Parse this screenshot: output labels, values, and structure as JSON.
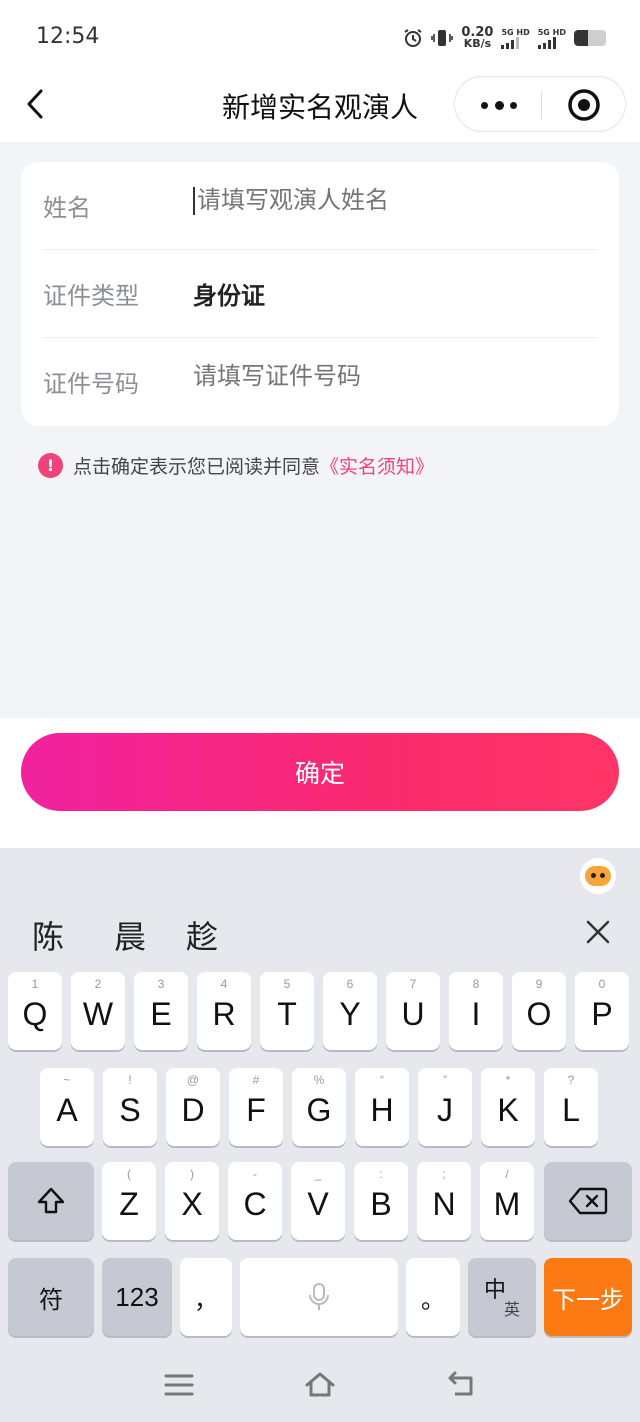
{
  "status_bar": {
    "time": "12:54",
    "speed_value": "0.20",
    "speed_unit": "KB/s",
    "sim1": "5G HD",
    "sim2": "5G HD",
    "battery_level": 0.45,
    "icons": [
      "alarm-icon",
      "vibrate-icon",
      "signal-icon",
      "battery-icon"
    ]
  },
  "nav": {
    "title": "新增实名观演人",
    "back_icon": "chevron-left-icon",
    "more_icon": "more-dots-icon",
    "close_icon": "target-circle-icon"
  },
  "form": {
    "name_label": "姓名",
    "name_placeholder": "请填写观演人姓名",
    "id_type_label": "证件类型",
    "id_type_value": "身份证",
    "id_number_label": "证件号码",
    "id_number_placeholder": "请填写证件号码"
  },
  "notice": {
    "text": "点击确定表示您已阅读并同意",
    "link": "《实名须知》"
  },
  "confirm_label": "确定",
  "colors": {
    "accent": "#f0437a",
    "button_gradient_start": "#f0229f",
    "button_gradient_end": "#ff3566",
    "next_key": "#fb7a14"
  },
  "keyboard": {
    "candidates": [
      "陈",
      "晨",
      "趁"
    ],
    "row1": [
      {
        "k": "Q",
        "h": "1"
      },
      {
        "k": "W",
        "h": "2"
      },
      {
        "k": "E",
        "h": "3"
      },
      {
        "k": "R",
        "h": "4"
      },
      {
        "k": "T",
        "h": "5"
      },
      {
        "k": "Y",
        "h": "6"
      },
      {
        "k": "U",
        "h": "7"
      },
      {
        "k": "I",
        "h": "8"
      },
      {
        "k": "O",
        "h": "9"
      },
      {
        "k": "P",
        "h": "0"
      }
    ],
    "row2": [
      {
        "k": "A",
        "h": "~"
      },
      {
        "k": "S",
        "h": "!"
      },
      {
        "k": "D",
        "h": "@"
      },
      {
        "k": "F",
        "h": "#"
      },
      {
        "k": "G",
        "h": "%"
      },
      {
        "k": "H",
        "h": "“"
      },
      {
        "k": "J",
        "h": "”"
      },
      {
        "k": "K",
        "h": "*"
      },
      {
        "k": "L",
        "h": "?"
      }
    ],
    "row3": [
      {
        "k": "Z",
        "h": "("
      },
      {
        "k": "X",
        "h": ")"
      },
      {
        "k": "C",
        "h": "-"
      },
      {
        "k": "V",
        "h": "_"
      },
      {
        "k": "B",
        "h": ":"
      },
      {
        "k": "N",
        "h": ";"
      },
      {
        "k": "M",
        "h": "/"
      }
    ],
    "symbols_key": "符",
    "numbers_key": "123",
    "comma_key": "，",
    "period_key": "。",
    "lang_key_main": "中",
    "lang_key_sub": "英",
    "next_key": "下一步"
  }
}
